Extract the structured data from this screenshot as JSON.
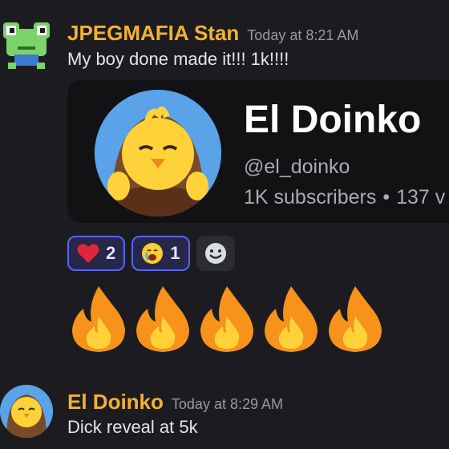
{
  "messages": [
    {
      "author": "JPEGMAFIA Stan",
      "timestamp": "Today at 8:21 AM",
      "text": "My boy done made it!!! 1k!!!!",
      "avatar_icon": "frog-avatar-icon"
    },
    {
      "author": "El Doinko",
      "timestamp": "Today at 8:29 AM",
      "text": "Dick reveal at 5k",
      "avatar_icon": "chick-avatar-icon"
    }
  ],
  "embed": {
    "channel_name": "El Doinko",
    "handle": "@el_doinko",
    "subscribers": "1K subscribers",
    "separator": "•",
    "videos": "137 v"
  },
  "reactions": [
    {
      "emoji": "red-heart-icon",
      "count": "2"
    },
    {
      "emoji": "crying-face-icon",
      "count": "1"
    }
  ],
  "add_reaction_icon": "smiley-add-reaction-icon",
  "fire_emoji_count": "5",
  "colors": {
    "background": "#1c1c20",
    "author": "#f0b232",
    "reaction_border": "#5865f2",
    "embed_bg": "#121214"
  }
}
